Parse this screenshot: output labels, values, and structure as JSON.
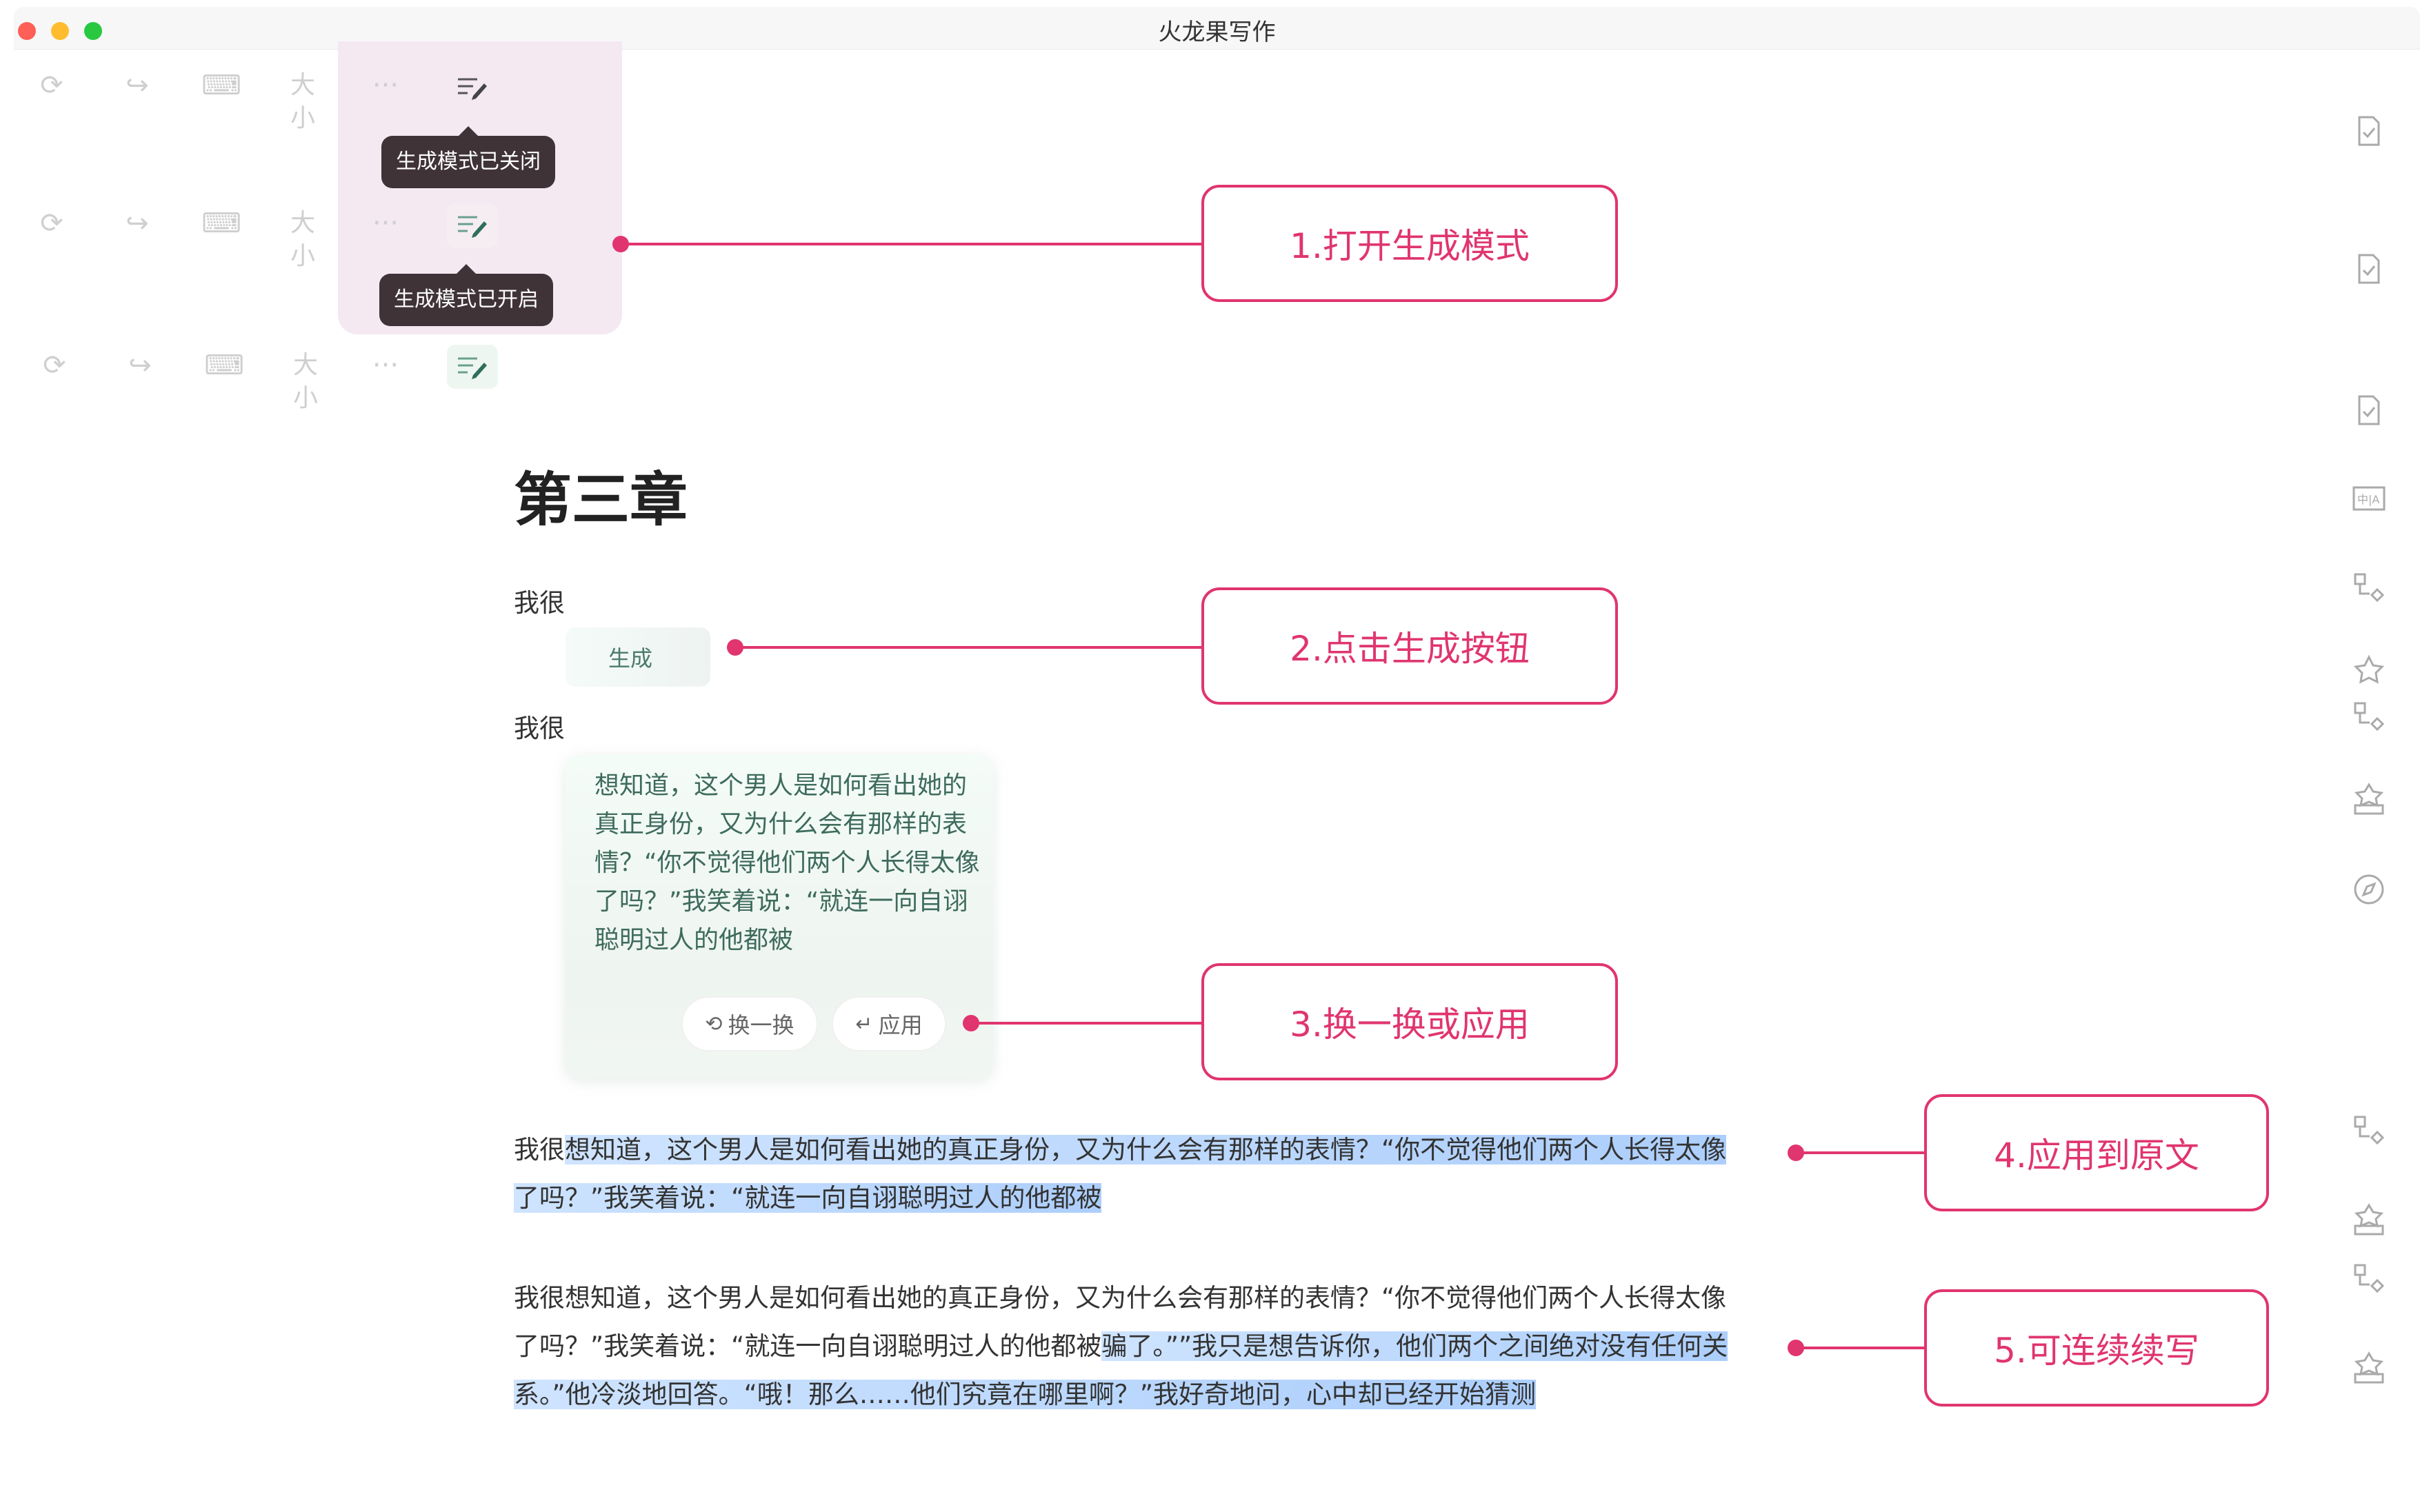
{
  "window": {
    "title": "火龙果写作"
  },
  "toolbar": {
    "icons": [
      "refresh-icon",
      "redo-icon",
      "keyboard-icon",
      "font-size-icon",
      "more-icon",
      "generate-mode-icon"
    ],
    "size_label": "大小",
    "more_label": "···"
  },
  "tooltips": {
    "mode_off": "生成模式已关闭",
    "mode_on": "生成模式已开启"
  },
  "callouts": {
    "c1": "1.打开生成模式",
    "c2": "2.点击生成按钮",
    "c3": "3.换一换或应用",
    "c4": "4.应用到原文",
    "c5": "5.可连续续写"
  },
  "document": {
    "heading": "第三章",
    "prompt_text_1": "我很",
    "generate_button": "生成",
    "prompt_text_2": "我很",
    "generated_suggestion": "想知道，这个男人是如何看出她的真正身份，又为什么会有那样的表情？“你不觉得他们两个人长得太像了吗？”我笑着说：“就连一向自诩聪明过人的他都被",
    "swap_button": "换一换",
    "apply_button": "应用",
    "applied": {
      "prefix": "我很",
      "line1_hl": "想知道，这个男人是如何看出她的真正身份，又为什么会有那样的表情？“你不觉得他们两个人长得太像",
      "line2_hl": "了吗？”我笑着说：“就连一向自诩聪明过人的他都被"
    },
    "continued": {
      "line1": "我很想知道，这个男人是如何看出她的真正身份，又为什么会有那样的表情？“你不觉得他们两个人长得太像",
      "line2_plain": "了吗？”我笑着说：“就连一向自诩聪明过人的他都被",
      "line2_hl": "骗了。””我只是想告诉你，他们两个之间绝对没有任何关",
      "line3_hl": "系。”他冷淡地回答。“哦！那么……他们究竟在哪里啊？”我好奇地问，心中却已经开始猜测"
    }
  },
  "colors": {
    "accent": "#e0356f",
    "generated_text": "#3e6b5d",
    "highlight": "#a6cdff",
    "tooltip_bg": "#3f3338"
  },
  "sidebar_icons": [
    "doc-check-icon",
    "doc-check-icon",
    "doc-check-icon",
    "translate-icon",
    "convert-icon",
    "star-box-icon",
    "convert-icon",
    "star-box-icon",
    "compass-icon",
    "convert-icon",
    "star-box-icon",
    "convert-icon",
    "star-box-icon"
  ]
}
